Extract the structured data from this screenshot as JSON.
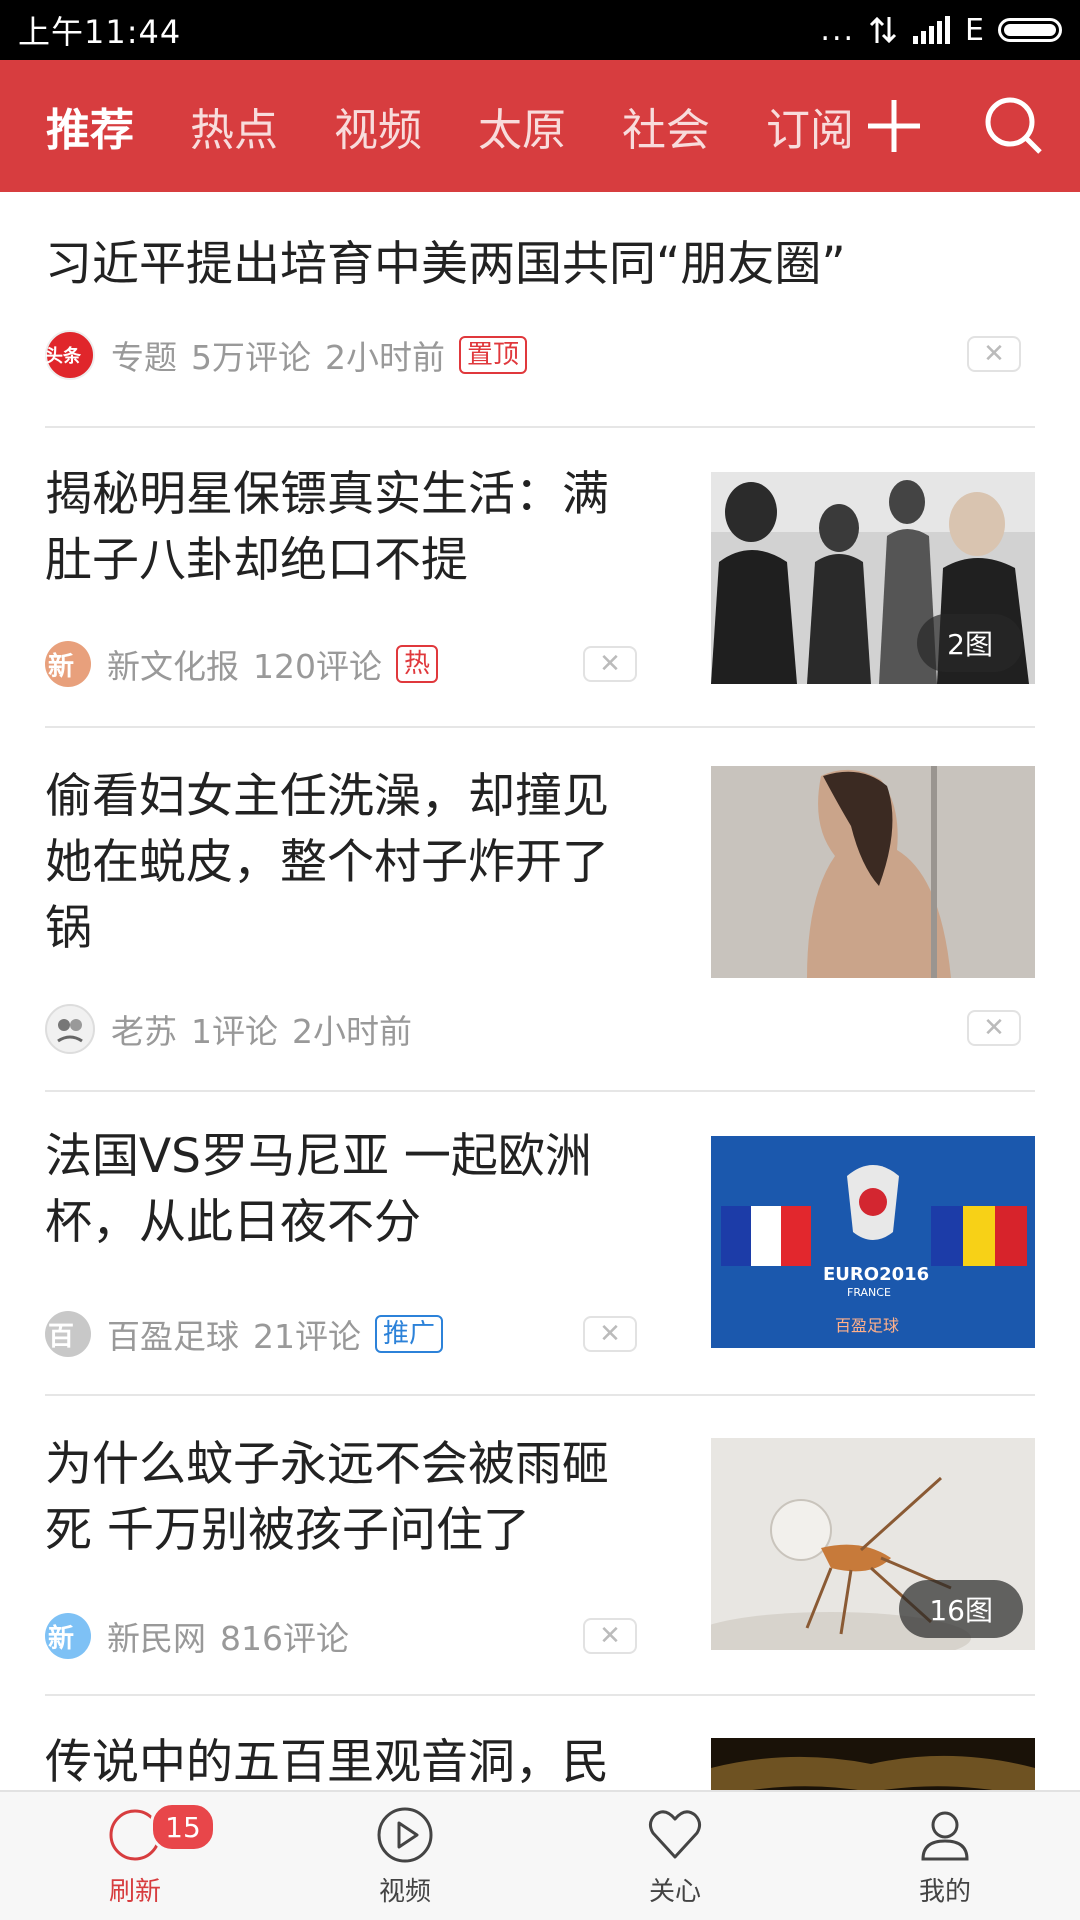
{
  "status_bar": {
    "time": "上午11:44",
    "dots": "...",
    "network": "E"
  },
  "top_nav": {
    "tabs": [
      {
        "label": "推荐",
        "active": true
      },
      {
        "label": "热点",
        "active": false
      },
      {
        "label": "视频",
        "active": false
      },
      {
        "label": "太原",
        "active": false
      },
      {
        "label": "社会",
        "active": false
      },
      {
        "label": "订阅",
        "active": false
      }
    ],
    "plus_icon": "plus-icon",
    "search_icon": "search-icon",
    "accent_color": "#d73d3f"
  },
  "feed": {
    "items": [
      {
        "title": "习近平提出培育中美两国共同“朋友圈”",
        "avatar_text": "头条",
        "source": "专题",
        "comments": "5万评论",
        "time": "2小时前",
        "tag": "置顶",
        "close": "✕"
      },
      {
        "title": "揭秘明星保镖真实生活：满肚子八卦却绝口不提",
        "avatar_text": "新",
        "source": "新文化报",
        "comments": "120评论",
        "tag": "热",
        "close": "✕",
        "pic_count": "2图"
      },
      {
        "title": "偷看妇女主任洗澡，却撞见她在蜕皮，整个村子炸开了锅",
        "source": "老苏",
        "comments": "1评论",
        "time": "2小时前",
        "close": "✕"
      },
      {
        "title": "法国VS罗马尼亚 一起欧洲杯，从此日夜不分",
        "avatar_text": "百",
        "source": "百盈足球",
        "comments": "21评论",
        "tag": "推广",
        "close": "✕",
        "image_text": {
          "logo": "EURO2016",
          "country": "FRANCE",
          "brand": "百盈足球"
        }
      },
      {
        "title": "为什么蚊子永远不会被雨砸死 千万别被孩子问住了",
        "avatar_text": "新",
        "source": "新民网",
        "comments": "816评论",
        "close": "✕",
        "pic_count": "16图"
      },
      {
        "title": "传说中的五百里观音洞，民"
      }
    ]
  },
  "bottom_nav": {
    "items": [
      {
        "label": "刷新",
        "icon": "refresh-icon",
        "active": true,
        "badge": "15"
      },
      {
        "label": "视频",
        "icon": "video-play-icon",
        "active": false
      },
      {
        "label": "关心",
        "icon": "heart-icon",
        "active": false
      },
      {
        "label": "我的",
        "icon": "user-icon",
        "active": false
      }
    ]
  }
}
